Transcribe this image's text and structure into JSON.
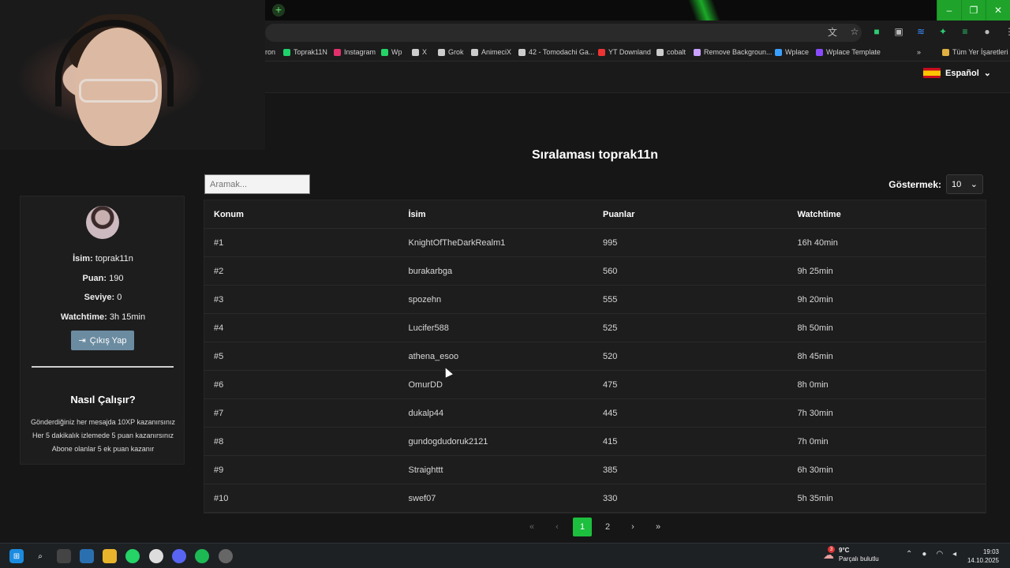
{
  "browser": {
    "bookmarks": [
      {
        "label": "ron",
        "color": "#888888"
      },
      {
        "label": "Toprak11N",
        "color": "#1fd16a"
      },
      {
        "label": "Instagram",
        "color": "#e1306c"
      },
      {
        "label": "Wp",
        "color": "#25d366"
      },
      {
        "label": "X",
        "color": "#cccccc"
      },
      {
        "label": "Grok",
        "color": "#cccccc"
      },
      {
        "label": "AnimeciX",
        "color": "#cccccc"
      },
      {
        "label": "42 - Tomodachi Ga...",
        "color": "#cccccc"
      },
      {
        "label": "YT Downland",
        "color": "#e33"
      },
      {
        "label": "cobalt",
        "color": "#cccccc"
      },
      {
        "label": "Remove Backgroun...",
        "color": "#c8a0ff"
      },
      {
        "label": "Wplace",
        "color": "#3aa0ff"
      },
      {
        "label": "Wplace Template",
        "color": "#8a4bff"
      },
      {
        "label": "»",
        "color": "#cccccc"
      },
      {
        "label": "Tüm Yer İşaretleri",
        "color": "#e0b040"
      }
    ],
    "new_tab": "+",
    "window_controls": [
      "–",
      "❐",
      "✕"
    ]
  },
  "header": {
    "language": "Español"
  },
  "main": {
    "title": "Sıralaması toprak11n",
    "search_placeholder": "Aramak...",
    "show_label": "Göstermek:",
    "show_value": "10",
    "columns": [
      "Konum",
      "İsim",
      "Puanlar",
      "Watchtime"
    ],
    "rows": [
      [
        "#1",
        "KnightOfTheDarkRealm1",
        "995",
        "16h 40min"
      ],
      [
        "#2",
        "burakarbga",
        "560",
        "9h 25min"
      ],
      [
        "#3",
        "spozehn",
        "555",
        "9h 20min"
      ],
      [
        "#4",
        "Lucifer588",
        "525",
        "8h 50min"
      ],
      [
        "#5",
        "athena_esoo",
        "520",
        "8h 45min"
      ],
      [
        "#6",
        "OmurDD",
        "475",
        "8h 0min"
      ],
      [
        "#7",
        "dukalp44",
        "445",
        "7h 30min"
      ],
      [
        "#8",
        "gundogdudoruk2121",
        "415",
        "7h 0min"
      ],
      [
        "#9",
        "Straighttt",
        "385",
        "6h 30min"
      ],
      [
        "#10",
        "swef07",
        "330",
        "5h 35min"
      ]
    ],
    "pagination": {
      "first": "«",
      "prev": "‹",
      "pages": [
        "1",
        "2"
      ],
      "current": "1",
      "next": "›",
      "last": "»"
    }
  },
  "profile": {
    "name_label": "İsim:",
    "name_value": "toprak11n",
    "points_label": "Puan:",
    "points_value": "190",
    "level_label": "Seviye:",
    "level_value": "0",
    "watch_label": "Watchtime:",
    "watch_value": "3h 15min",
    "logout_label": "Çıkış Yap",
    "how_title": "Nasıl Çalışır?",
    "how_lines": [
      "Gönderdiğiniz her mesajda 10XP kazanırsınız",
      "Her 5 dakikalık izlemede 5 puan kazanırsınız",
      "Abone olanlar 5 ek puan kazanır"
    ]
  },
  "taskbar": {
    "temp": "9°C",
    "weather": "Parçalı bulutlu",
    "weather_badge": "3",
    "time": "19:03",
    "date": "14.10.2025"
  },
  "colors": {
    "accent": "#1dbf3e",
    "logout_button": "#6b8ba0"
  }
}
